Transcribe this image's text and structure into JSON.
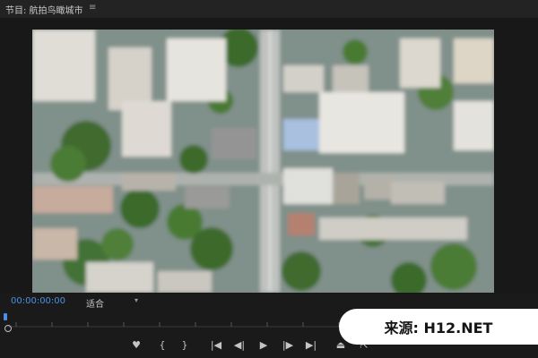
{
  "panel": {
    "title": "节目: 航拍鸟瞰城市",
    "menu_icon": "hamburger-menu-icon"
  },
  "viewer": {
    "content": "aerial-city-video-frame"
  },
  "bottom_bar": {
    "timecode": "00:00:00:00",
    "fit_label": "适合"
  },
  "controls": {
    "marker": "add-marker-icon",
    "in_point": "{",
    "out_point": "}",
    "go_to_in": "go-to-in-icon",
    "step_back": "step-back-icon",
    "play": "play-icon",
    "step_forward": "step-forward-icon",
    "go_to_out": "go-to-out-icon",
    "lift": "lift-icon",
    "extract": "extract-icon"
  },
  "watermark": {
    "text": "来源: H12.NET"
  }
}
